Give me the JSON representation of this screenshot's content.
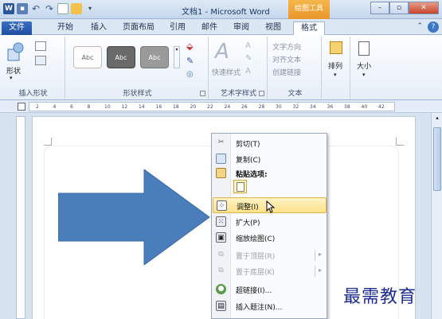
{
  "window": {
    "title": "文档1 - Microsoft Word",
    "context_tab": "绘图工具"
  },
  "tabs": [
    "文件",
    "开始",
    "插入",
    "页面布局",
    "引用",
    "邮件",
    "审阅",
    "视图",
    "格式"
  ],
  "ribbon": {
    "insert_shapes": {
      "label": "插入形状",
      "shape_button": "形状"
    },
    "shape_styles": {
      "label": "形状样式",
      "thumbs": [
        "Abc",
        "Abc",
        "Abc"
      ]
    },
    "wordart": {
      "label": "艺术字样式",
      "quick_styles": "快速样式"
    },
    "text": {
      "label": "文本",
      "items": [
        "文字方向",
        "对齐文本",
        "创建链接"
      ]
    },
    "arrange": {
      "label": "排列"
    },
    "size": {
      "label": "大小"
    }
  },
  "ruler": {
    "ticks": [
      "2",
      "4",
      "6",
      "8",
      "10",
      "12",
      "14",
      "16",
      "18",
      "20",
      "22",
      "24",
      "26",
      "28",
      "30",
      "32",
      "34",
      "36",
      "38",
      "40",
      "42"
    ]
  },
  "context_menu": {
    "items": [
      {
        "label": "剪切(T)",
        "icon": "scissors-icon",
        "enabled": true
      },
      {
        "label": "复制(C)",
        "icon": "copy-icon",
        "enabled": true
      },
      {
        "label": "粘贴选项:",
        "icon": "paste-icon",
        "enabled": true
      },
      {
        "label": "调整(I)",
        "icon": "adjust-icon",
        "enabled": true,
        "highlight": true
      },
      {
        "label": "扩大(P)",
        "icon": "expand-icon",
        "enabled": true
      },
      {
        "label": "缩放绘图(C)",
        "icon": "scale-drawing-icon",
        "enabled": true
      },
      {
        "label": "置于顶层(R)",
        "icon": "bring-to-front-icon",
        "enabled": false,
        "submenu": true
      },
      {
        "label": "置于底层(K)",
        "icon": "send-to-back-icon",
        "enabled": false,
        "submenu": true
      },
      {
        "label": "超链接(I)...",
        "icon": "hyperlink-icon",
        "enabled": true
      },
      {
        "label": "插入题注(N)...",
        "icon": "caption-icon",
        "enabled": true
      }
    ]
  },
  "watermark": "最需教育",
  "colors": {
    "arrow": "#4a7ebb",
    "menu_highlight": "#fde28a",
    "context_tab": "#f0a840"
  }
}
